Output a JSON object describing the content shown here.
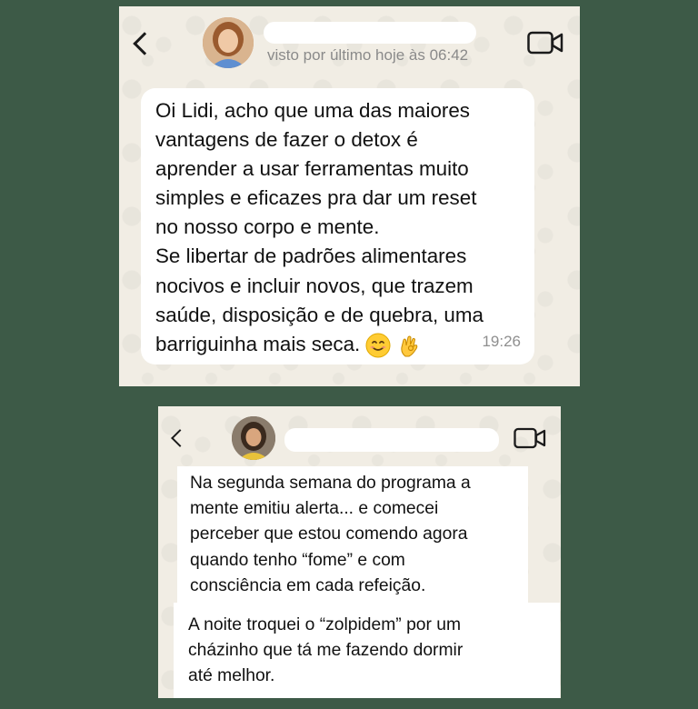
{
  "screenshot_1": {
    "status": "visto por último hoje às 06:42",
    "message": {
      "lines": [
        "Oi Lidi, acho que uma das maiores",
        "vantagens de fazer o detox é",
        "aprender a usar ferramentas muito",
        "simples e eficazes pra dar um reset",
        "no nosso corpo e mente.",
        "Se libertar de padrões alimentares",
        "nocivos e incluir novos, que trazem",
        "saúde, disposição e de quebra, uma",
        "barriguinha mais seca."
      ],
      "time": "19:26"
    },
    "icons": [
      "back-chevron",
      "video-camera",
      "smiling-face-emoji",
      "ok-hand-emoji"
    ]
  },
  "screenshot_2": {
    "messages": [
      {
        "lines": [
          "Na segunda semana do programa a",
          "mente emitiu alerta... e comecei",
          "perceber que estou comendo agora",
          "quando tenho “fome” e com",
          "consciência em cada refeição."
        ]
      },
      {
        "lines": [
          "A noite troquei o “zolpidem” por um",
          "cházinho que tá me fazendo dormir",
          "até melhor."
        ]
      }
    ],
    "icons": [
      "back-chevron",
      "video-camera"
    ]
  },
  "colors": {
    "page_background": "#3d5a47",
    "chat_background": "#f1ede4",
    "bubble": "#ffffff",
    "text": "#111111",
    "meta_text": "#8a8a8a"
  }
}
